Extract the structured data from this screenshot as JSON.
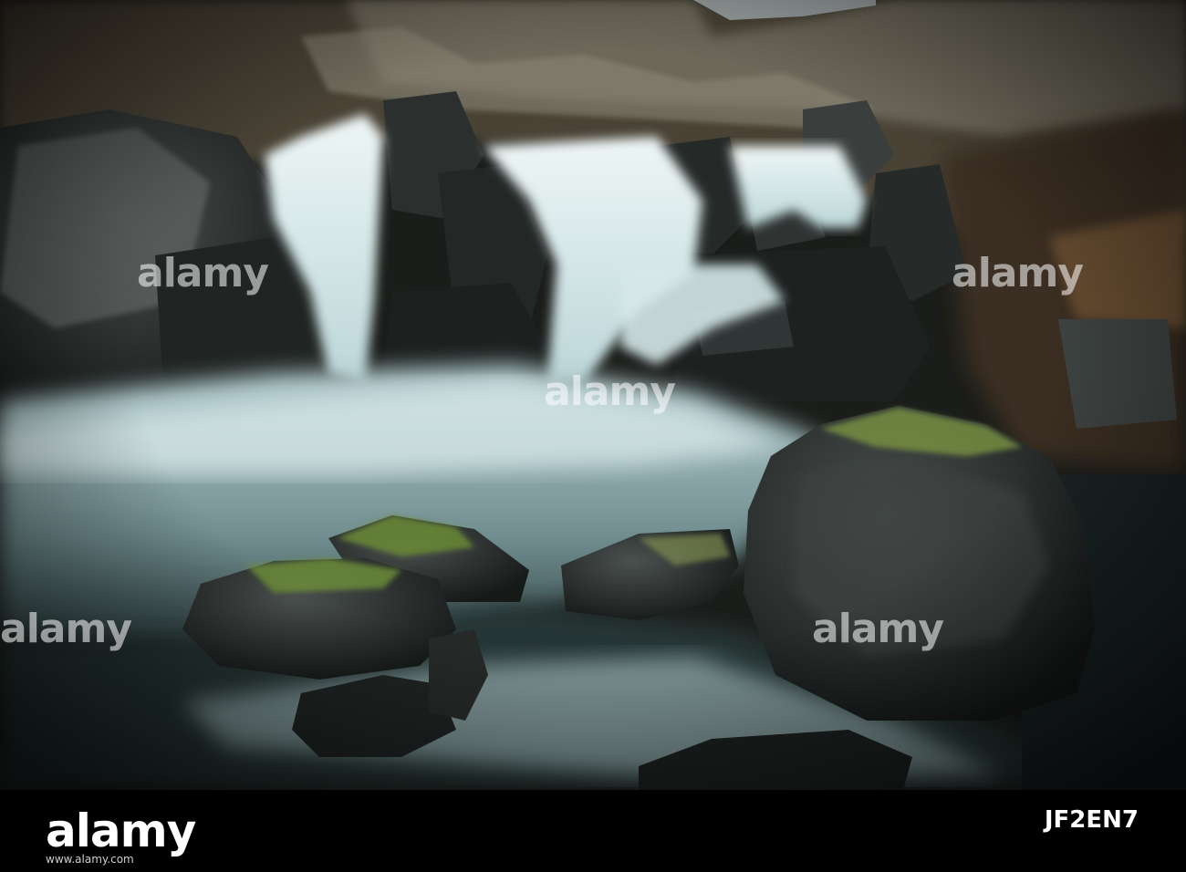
{
  "watermark": {
    "text": "alamy"
  },
  "footer": {
    "brand": "alamy",
    "url": "www.alamy.com",
    "image_id": "JF2EN7"
  },
  "colors": {
    "water": "#cfe3e4",
    "rock": "#1f2424",
    "moss": "#7a9a3a",
    "hillside": "#5b5040",
    "bar": "#000000"
  }
}
